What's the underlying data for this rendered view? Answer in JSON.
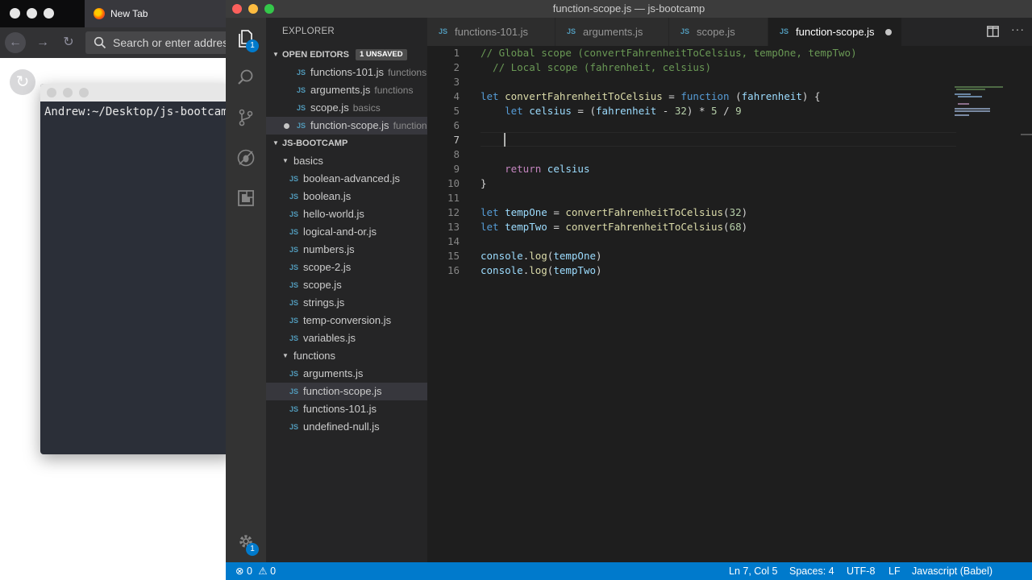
{
  "browser": {
    "tab_title": "New Tab",
    "url_placeholder": "Search or enter address"
  },
  "terminal": {
    "prompt": "Andrew:~/Desktop/js-bootcamp"
  },
  "window": {
    "title": "function-scope.js — js-bootcamp"
  },
  "activity": {
    "explorer_badge": "1",
    "settings_badge": "1"
  },
  "sidebar": {
    "title": "EXPLORER",
    "open_editors_label": "OPEN EDITORS",
    "unsaved_label": "1 UNSAVED",
    "open_editors": [
      {
        "name": "functions-101.js",
        "desc": "functions"
      },
      {
        "name": "arguments.js",
        "desc": "functions"
      },
      {
        "name": "scope.js",
        "desc": "basics"
      },
      {
        "name": "function-scope.js",
        "desc": "functions"
      }
    ],
    "project_label": "JS-BOOTCAMP",
    "folders": [
      {
        "name": "basics",
        "files": [
          "boolean-advanced.js",
          "boolean.js",
          "hello-world.js",
          "logical-and-or.js",
          "numbers.js",
          "scope-2.js",
          "scope.js",
          "strings.js",
          "temp-conversion.js",
          "variables.js"
        ]
      },
      {
        "name": "functions",
        "files": [
          "arguments.js",
          "function-scope.js",
          "functions-101.js",
          "undefined-null.js"
        ]
      }
    ],
    "js_glyph": "JS"
  },
  "tabs": [
    {
      "label": "functions-101.js"
    },
    {
      "label": "arguments.js"
    },
    {
      "label": "scope.js"
    },
    {
      "label": "function-scope.js"
    }
  ],
  "code": {
    "line_numbers": [
      "1",
      "2",
      "3",
      "4",
      "5",
      "6",
      "7",
      "8",
      "9",
      "10",
      "11",
      "12",
      "13",
      "14",
      "15",
      "16"
    ],
    "l1": "// Global scope (convertFahrenheitToCelsius, tempOne, tempTwo)",
    "l2": "  // Local scope (fahrenheit, celsius)",
    "l4": {
      "kw": "let",
      "name": "convertFahrenheitToCelsius",
      "eq": " = ",
      "fn": "function",
      "open": " (",
      "param": "fahrenheit",
      "close": ") {"
    },
    "l5": {
      "kw": "let",
      "name": "celsius",
      "eq": " = (",
      "param": "fahrenheit",
      "minus": " - ",
      "n1": "32",
      "rest1": ") * ",
      "n2": "5",
      "rest2": " / ",
      "n3": "9"
    },
    "l9": {
      "kw": "return",
      "name": "celsius"
    },
    "l10": "}",
    "l12": {
      "kw": "let",
      "name": "tempOne",
      "eq": " = ",
      "call": "convertFahrenheitToCelsius",
      "open": "(",
      "arg": "32",
      "close": ")"
    },
    "l13": {
      "kw": "let",
      "name": "tempTwo",
      "eq": " = ",
      "call": "convertFahrenheitToCelsius",
      "open": "(",
      "arg": "68",
      "close": ")"
    },
    "l15": {
      "obj": "console",
      "dot": ".",
      "method": "log",
      "open": "(",
      "arg": "tempOne",
      "close": ")"
    },
    "l16": {
      "obj": "console",
      "dot": ".",
      "method": "log",
      "open": "(",
      "arg": "tempTwo",
      "close": ")"
    }
  },
  "status": {
    "errors": "0",
    "warnings": "0",
    "position": "Ln 7, Col 5",
    "spaces": "Spaces: 4",
    "encoding": "UTF-8",
    "eol": "LF",
    "language": "Javascript (Babel)"
  },
  "colors": {
    "accent": "#007acc",
    "comment": "#6a9955",
    "keyword": "#569cd6",
    "function": "#dcdcaa",
    "variable": "#9cdcfe",
    "number": "#b5cea8"
  },
  "icons": [
    "firefox-icon",
    "back-icon",
    "forward-icon",
    "reload-icon",
    "search-icon",
    "files-icon",
    "search-icon",
    "source-control-icon",
    "debug-icon",
    "extensions-icon",
    "gear-icon",
    "split-editor-icon",
    "more-icon",
    "error-icon",
    "warning-icon"
  ]
}
